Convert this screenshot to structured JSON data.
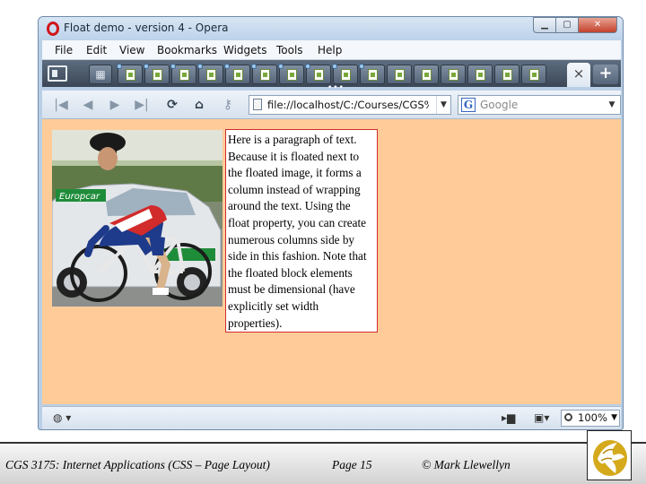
{
  "window": {
    "title": "Float demo - version 4 - Opera",
    "controls": {
      "minimize": "▁",
      "maximize": "▢",
      "close": "✕"
    }
  },
  "menu": [
    "File",
    "Edit",
    "View",
    "Bookmarks",
    "Widgets",
    "Tools",
    "Help"
  ],
  "tabs": {
    "active_close": "×",
    "add": "+",
    "overflow": "•••"
  },
  "nav": {
    "first": "|◀",
    "back": "◀",
    "forward": "▶",
    "last": "▶|",
    "reload": "⟳",
    "home": "⌂",
    "key": "⚷",
    "address": "file://localhost/C:/Courses/CGS%2",
    "search_engine_letter": "G",
    "search_placeholder": "Google"
  },
  "content": {
    "image_alt": "Cyclist on a racing bike in front of a Europcar car",
    "car_brand": "Europcar",
    "paragraph": "Here is a paragraph of text. Because it is floated next to the floated image, it forms a column instead of wrapping around the text. Using the float property, you can create numerous columns side by side in this fashion. Note that the floated block elements must be dimensional (have explicitly set width properties)."
  },
  "status": {
    "zoom": "100%"
  },
  "footer": {
    "course": "CGS 3175: Internet Applications (CSS – Page Layout)",
    "page": "Page 15",
    "copyright": "© Mark Llewellyn"
  },
  "colors": {
    "page_bg": "#ffcc99",
    "para_border": "#d22b2b"
  }
}
